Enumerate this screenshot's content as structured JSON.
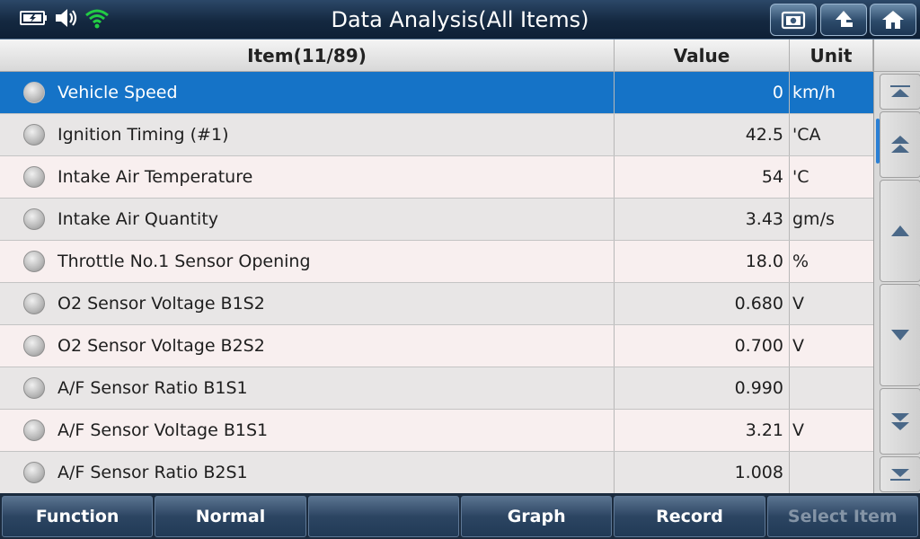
{
  "header": {
    "title": "Data Analysis(All Items)"
  },
  "table": {
    "columns": {
      "item": "Item(11/89)",
      "value": "Value",
      "unit": "Unit"
    },
    "rows": [
      {
        "name": "Vehicle Speed",
        "value": "0",
        "unit": "km/h"
      },
      {
        "name": "Ignition Timing (#1)",
        "value": "42.5",
        "unit": "'CA"
      },
      {
        "name": "Intake Air Temperature",
        "value": "54",
        "unit": "'C"
      },
      {
        "name": "Intake Air Quantity",
        "value": "3.43",
        "unit": "gm/s"
      },
      {
        "name": "Throttle No.1 Sensor Opening",
        "value": "18.0",
        "unit": "%"
      },
      {
        "name": "O2 Sensor Voltage B1S2",
        "value": "0.680",
        "unit": "V"
      },
      {
        "name": "O2 Sensor Voltage B2S2",
        "value": "0.700",
        "unit": "V"
      },
      {
        "name": "A/F Sensor Ratio B1S1",
        "value": "0.990",
        "unit": ""
      },
      {
        "name": "A/F Sensor Voltage B1S1",
        "value": "3.21",
        "unit": "V"
      },
      {
        "name": "A/F Sensor Ratio B2S1",
        "value": "1.008",
        "unit": ""
      }
    ]
  },
  "bottom": {
    "function": "Function",
    "normal": "Normal",
    "blank": "",
    "graph": "Graph",
    "record": "Record",
    "select_item": "Select Item"
  },
  "colors": {
    "selected_row": "#1573c7",
    "title_bar": "#142840",
    "wifi": "#22cc44"
  }
}
